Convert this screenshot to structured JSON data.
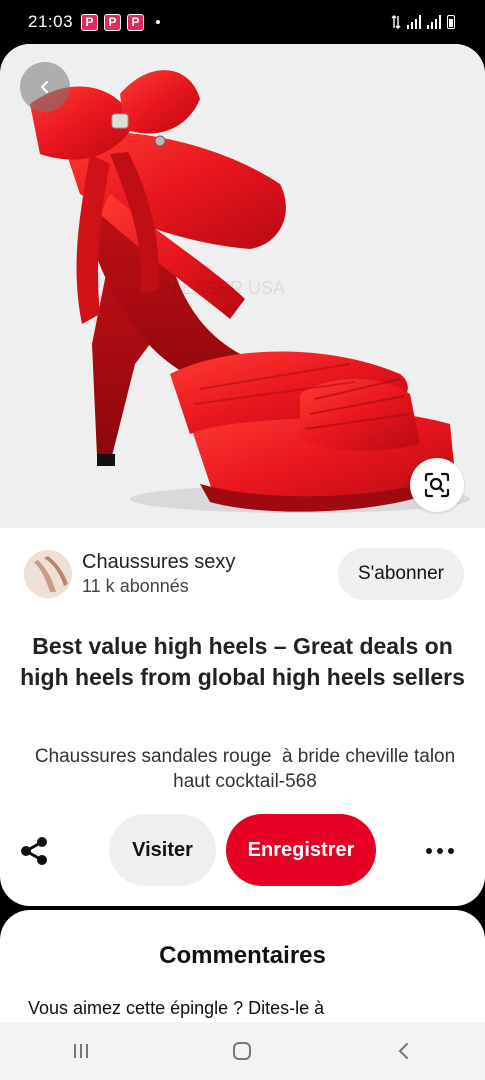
{
  "status_bar": {
    "time": "21:03",
    "app_badges": [
      "P",
      "P",
      "P"
    ]
  },
  "pin": {
    "image_alt": "Red satin platform high heel sandal",
    "watermark": "PLEASER USA",
    "creator": {
      "name": "Chaussures sexy",
      "followers": "11 k abonnés",
      "follow_label": "S'abonner"
    },
    "title": "Best value high heels – Great deals on high heels from global high heels sellers",
    "description": "Chaussures sandales rouge  à bride cheville talon haut cocktail-568",
    "actions": {
      "visit_label": "Visiter",
      "save_label": "Enregistrer"
    }
  },
  "comments": {
    "title": "Commentaires",
    "prompt": "Vous aimez cette épingle ? Dites-le à"
  },
  "colors": {
    "save_red": "#e60023",
    "shoe_red": "#e8161e",
    "button_gray": "#efefef"
  },
  "icons": {
    "back": "chevron-left-icon",
    "visual_search": "visual-search-icon",
    "share": "share-icon",
    "more": "more-dots-icon",
    "nav_recents": "recents-icon",
    "nav_home": "home-icon",
    "nav_back": "nav-back-icon"
  }
}
